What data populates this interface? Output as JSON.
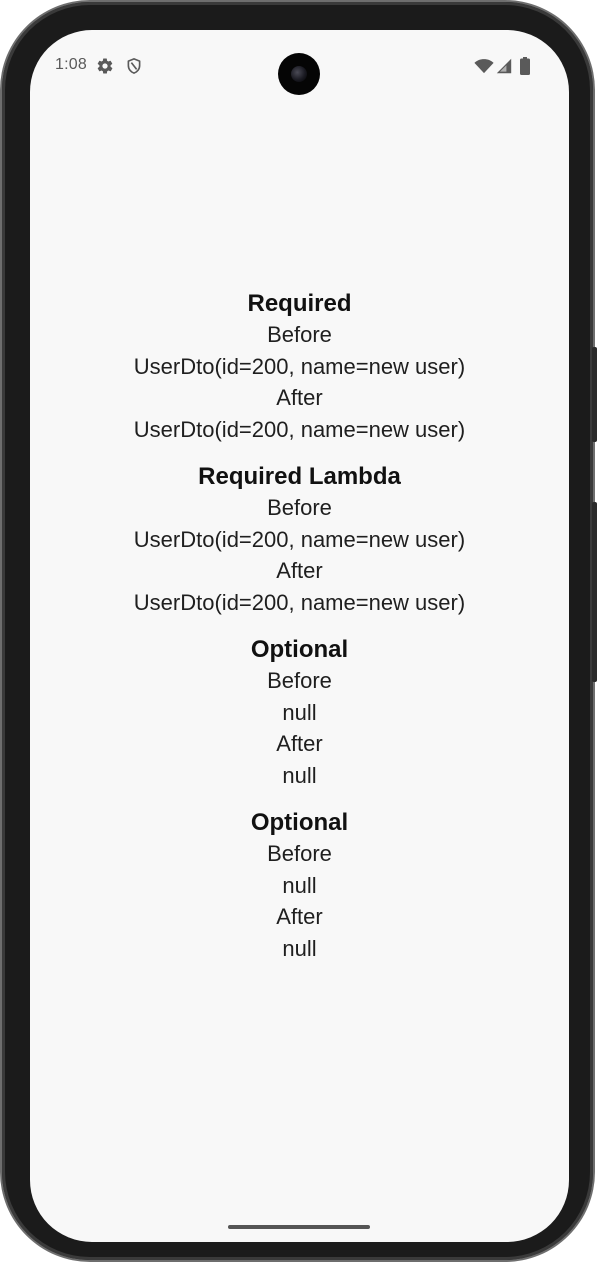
{
  "status_bar": {
    "time": "1:08",
    "left_icons": [
      "settings-icon",
      "shield-icon"
    ],
    "right_icons": [
      "wifi-icon",
      "cell-signal-icon",
      "battery-icon"
    ]
  },
  "sections": [
    {
      "title": "Required",
      "before_label": "Before",
      "before_value": "UserDto(id=200, name=new user)",
      "after_label": "After",
      "after_value": "UserDto(id=200, name=new user)"
    },
    {
      "title": "Required Lambda",
      "before_label": "Before",
      "before_value": "UserDto(id=200, name=new user)",
      "after_label": "After",
      "after_value": "UserDto(id=200, name=new user)"
    },
    {
      "title": "Optional",
      "before_label": "Before",
      "before_value": "null",
      "after_label": "After",
      "after_value": "null"
    },
    {
      "title": "Optional",
      "before_label": "Before",
      "before_value": "null",
      "after_label": "After",
      "after_value": "null"
    }
  ]
}
